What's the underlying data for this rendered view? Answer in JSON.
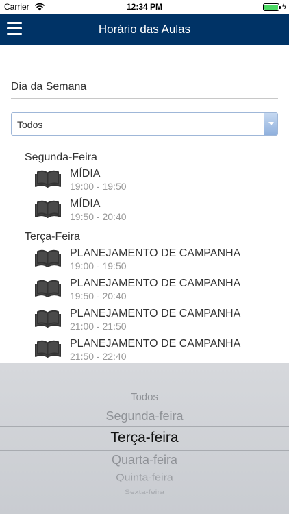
{
  "status_bar": {
    "carrier": "Carrier",
    "time": "12:34 PM"
  },
  "header": {
    "title": "Horário das Aulas"
  },
  "filter": {
    "label": "Dia da Semana",
    "selected": "Todos"
  },
  "schedule": [
    {
      "day": "Segunda-Feira",
      "classes": [
        {
          "name": "MÍDIA",
          "time": "19:00 - 19:50"
        },
        {
          "name": "MÍDIA",
          "time": "19:50 - 20:40"
        }
      ]
    },
    {
      "day": "Terça-Feira",
      "classes": [
        {
          "name": "PLANEJAMENTO DE CAMPANHA",
          "time": "19:00 - 19:50"
        },
        {
          "name": "PLANEJAMENTO DE CAMPANHA",
          "time": "19:50 - 20:40"
        },
        {
          "name": "PLANEJAMENTO DE CAMPANHA",
          "time": "21:00 - 21:50"
        },
        {
          "name": "PLANEJAMENTO DE CAMPANHA",
          "time": "21:50 - 22:40"
        }
      ]
    }
  ],
  "picker": {
    "options": [
      "Todos",
      "Segunda-feira",
      "Terça-feira",
      "Quarta-feira",
      "Quinta-feira",
      "Sexta-feira"
    ],
    "selected": "Terça-feira"
  },
  "colors": {
    "nav_background": "#003366",
    "battery": "#4cd964"
  },
  "icons": {
    "menu": "menu-icon",
    "book": "book-icon",
    "wifi": "wifi-icon",
    "battery": "battery-icon"
  }
}
